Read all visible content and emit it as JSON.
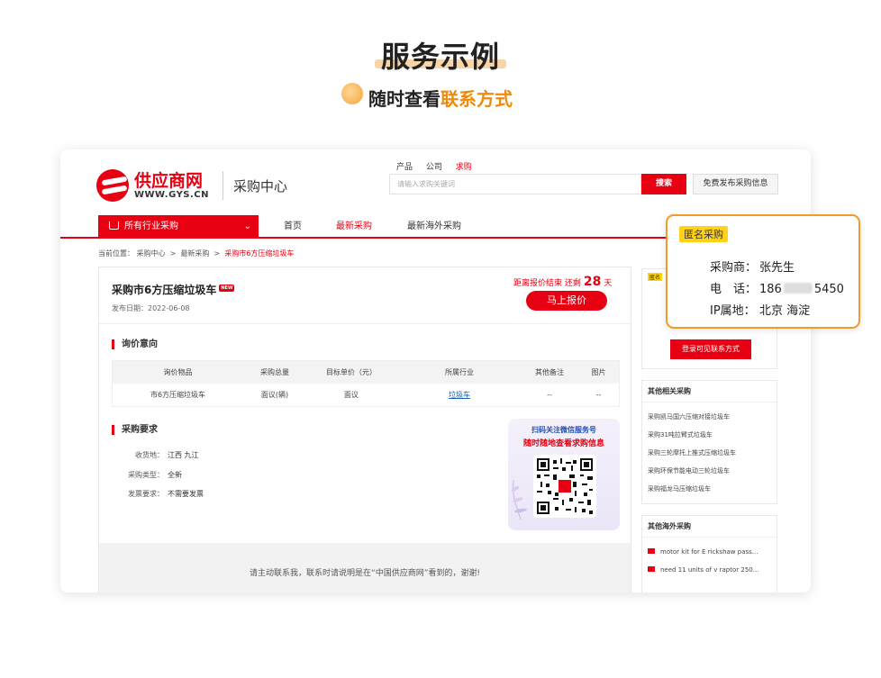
{
  "hero": {
    "title": "服务示例",
    "subtitle_plain": "随时查看",
    "subtitle_accent": "联系方式"
  },
  "site": {
    "logo_cn": "供应商网",
    "logo_en": "WWW.GYS.CN",
    "section_title": "采购中心"
  },
  "search": {
    "tabs": [
      "产品",
      "公司",
      "求购"
    ],
    "active_tab": "求购",
    "placeholder": "请输入求购关键词",
    "button": "搜索",
    "publish": "免费发布采购信息"
  },
  "nav": {
    "category": "所有行业采购",
    "links": [
      "首页",
      "最新采购",
      "最新海外采购"
    ],
    "active": "最新采购"
  },
  "breadcrumb": {
    "prefix": "当前位置：",
    "items": [
      "采购中心",
      "最新采购"
    ],
    "current": "采购市6方压缩垃圾车",
    "sep": ">"
  },
  "listing": {
    "title": "采购市6方压缩垃圾车",
    "new_badge": "NEW",
    "date_label": "发布日期：",
    "date": "2022-06-08",
    "countdown_prefix": "距离报价结束 还剩",
    "countdown_value": "28",
    "countdown_unit": "天",
    "quote_button": "马上报价"
  },
  "inquiry": {
    "heading": "询价意向",
    "columns": [
      "询价物品",
      "采购总量",
      "目标单价（元）",
      "所属行业",
      "其他备注",
      "图片"
    ],
    "rows": [
      [
        "市6方压缩垃圾车",
        "面议(辆)",
        "面议",
        "垃圾车",
        "--",
        "--"
      ]
    ]
  },
  "requirements": {
    "heading": "采购要求",
    "items": [
      {
        "label": "收货地：",
        "value": "江西 九江"
      },
      {
        "label": "采购类型：",
        "value": "全新"
      },
      {
        "label": "发票要求：",
        "value": "不需要发票"
      }
    ]
  },
  "qr": {
    "line1": "扫码关注微信服务号",
    "line2": "随时随地查看求购信息"
  },
  "footer": {
    "text": "请主动联系我，联系时请说明是在“中国供应商网”看到的，谢谢!"
  },
  "sidebar": {
    "buyer_badge": "匿名",
    "register_button": "登录可见联系方式",
    "related_heading": "其他相关采购",
    "related_items": [
      "采购凯马国六压缩对接垃圾车",
      "采购31吨拉臂式垃圾车",
      "采购三轮摩托上推式压缩垃圾车",
      "采购环保节能电动三轮垃圾车",
      "采购福龙马压缩垃圾车"
    ],
    "overseas_heading": "其他海外采购",
    "overseas_items": [
      "motor kit for E rickshaw pass...",
      "need 11 units of v raptor 250..."
    ]
  },
  "popup": {
    "badge": "匿名采购",
    "buyer_label": "采购商：",
    "buyer_value": "张先生",
    "phone_label": "电　话：",
    "phone_prefix": "186",
    "phone_suffix": "5450",
    "ip_label": "IP属地：",
    "ip_value": "北京 海淀"
  },
  "colors": {
    "brand_red": "#e60012",
    "accent_orange": "#f08a0a",
    "popup_border": "#f39a28"
  }
}
